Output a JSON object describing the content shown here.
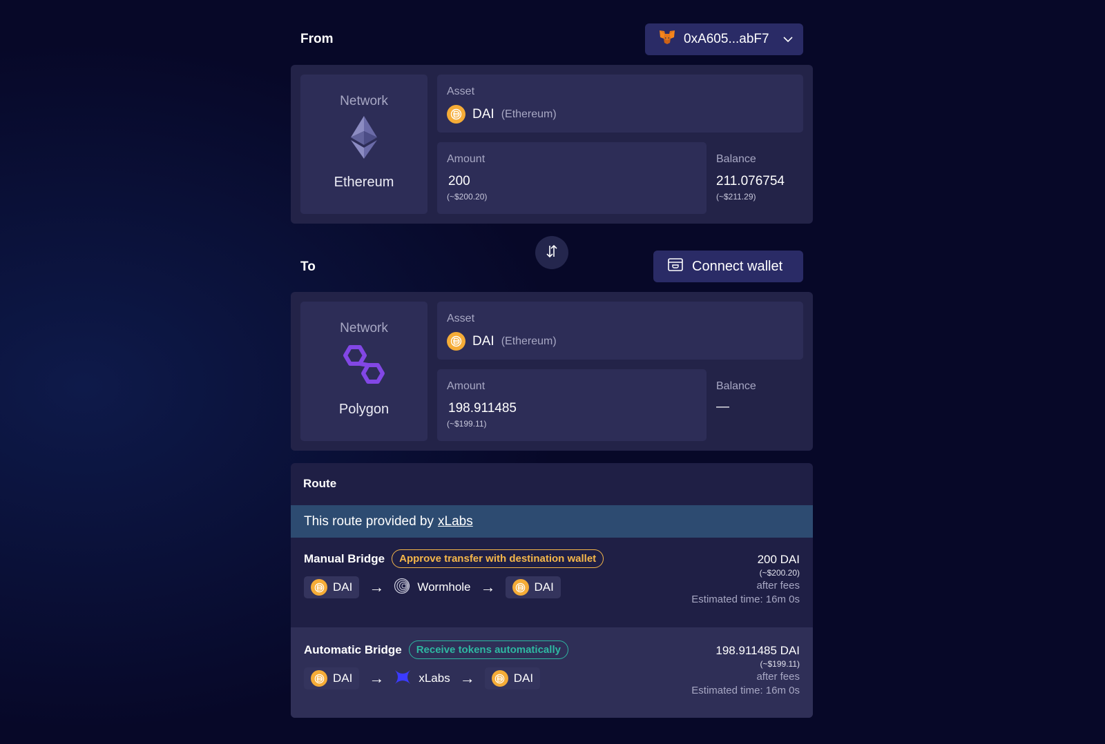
{
  "from": {
    "title": "From",
    "wallet": {
      "address": "0xA605...abF7",
      "icon": "metamask-fox-icon"
    },
    "network": {
      "label": "Network",
      "name": "Ethereum",
      "icon": "ethereum-icon"
    },
    "asset": {
      "label": "Asset",
      "symbol": "DAI",
      "chain": "(Ethereum)",
      "icon": "dai-icon"
    },
    "amount": {
      "label": "Amount",
      "value": "200",
      "usd": "(~$200.20)"
    },
    "balance": {
      "label": "Balance",
      "value": "211.076754",
      "usd": "(~$211.29)"
    }
  },
  "swap": {
    "icon": "swap-arrows-icon"
  },
  "to": {
    "title": "To",
    "connect_label": "Connect wallet",
    "network": {
      "label": "Network",
      "name": "Polygon",
      "icon": "polygon-icon"
    },
    "asset": {
      "label": "Asset",
      "symbol": "DAI",
      "chain": "(Ethereum)",
      "icon": "dai-icon"
    },
    "amount": {
      "label": "Amount",
      "value": "198.911485",
      "usd": "(~$199.11)"
    },
    "balance": {
      "label": "Balance",
      "value": "—"
    }
  },
  "route": {
    "title": "Route",
    "provider_text": "This route provided by",
    "provider_link": "xLabs",
    "options": [
      {
        "name": "Manual Bridge",
        "badge": "Approve transfer with destination wallet",
        "path": [
          "DAI",
          "Wormhole",
          "DAI"
        ],
        "amount": "200 DAI",
        "usd": "(~$200.20)",
        "fees": "after fees",
        "eta": "Estimated time: 16m 0s"
      },
      {
        "name": "Automatic Bridge",
        "badge": "Receive tokens automatically",
        "path": [
          "DAI",
          "xLabs",
          "DAI"
        ],
        "amount": "198.911485 DAI",
        "usd": "(~$199.11)",
        "fees": "after fees",
        "eta": "Estimated time: 16m 0s"
      }
    ]
  },
  "colors": {
    "background": "#070828",
    "panel": "#232348",
    "button": "#2a2b66",
    "dai": "#f5ac37",
    "polygon": "#8247e5",
    "badge_orange": "#f5b74a",
    "badge_teal": "#2fb8a2"
  }
}
